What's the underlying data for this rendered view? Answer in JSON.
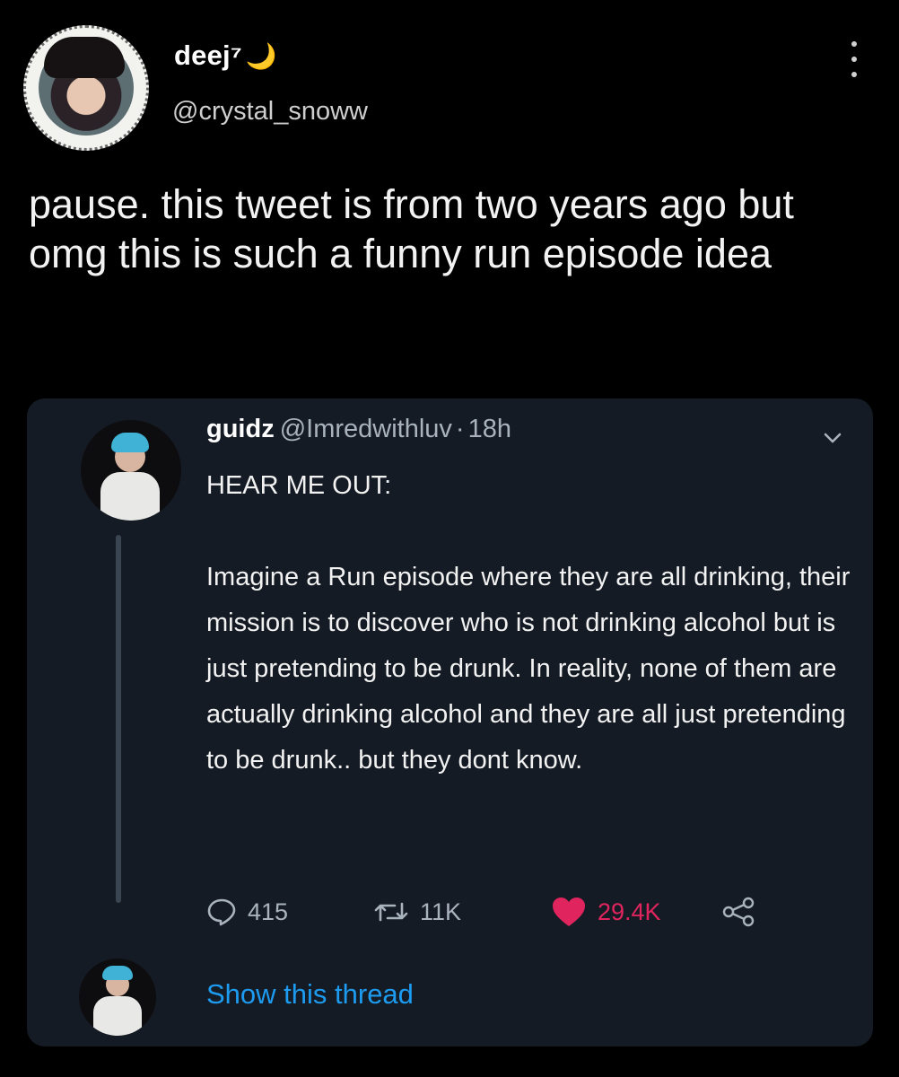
{
  "author": {
    "display_name": "deej⁷",
    "moon_emoji": "🌙",
    "handle": "@crystal_snoww",
    "avatar_icon": "profile-photo"
  },
  "tweet": {
    "text": "pause. this tweet is from two years ago but omg this is such a funny run episode idea"
  },
  "quoted": {
    "name": "guidz",
    "handle": "@Imredwithluv",
    "separator": "·",
    "time": "18h",
    "lines": [
      "HEAR ME OUT:",
      "",
      "Imagine a Run episode where they are all drinking, their mission is to discover who is not drinking alcohol but is just pretending to be drunk. In reality, none of them are actually drinking alcohol and they are all just pretending to be drunk.. but they dont know."
    ],
    "actions": {
      "replies": "415",
      "retweets": "11K",
      "likes": "29.4K"
    },
    "show_thread_label": "Show this thread"
  },
  "colors": {
    "background": "#000000",
    "card": "#151b24",
    "like": "#e0245e",
    "link": "#1d9bf0",
    "muted": "#a9b3bd"
  }
}
